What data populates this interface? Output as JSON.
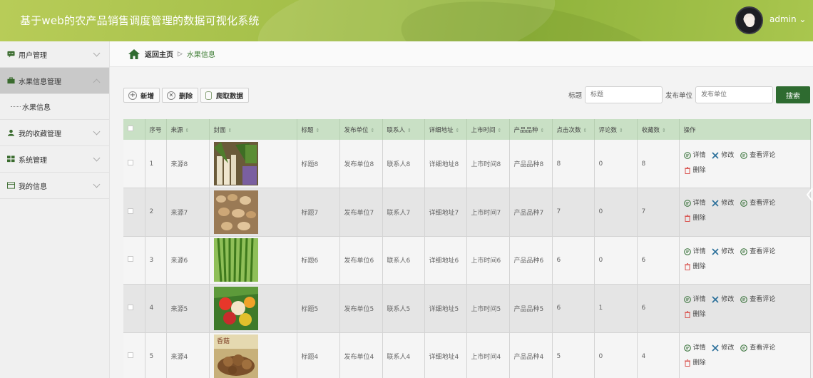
{
  "header": {
    "title": "基于web的农产品销售调度管理的数据可视化系统",
    "user": "admin ⌄"
  },
  "sidebar": {
    "items": [
      {
        "label": "用户管理",
        "icon": "chat-icon",
        "expanded": false
      },
      {
        "label": "水果信息管理",
        "icon": "briefcase-icon",
        "expanded": true,
        "children": [
          {
            "label": "水果信息"
          }
        ]
      },
      {
        "label": "我的收藏管理",
        "icon": "user-icon",
        "expanded": false
      },
      {
        "label": "系统管理",
        "icon": "grid-icon",
        "expanded": false
      },
      {
        "label": "我的信息",
        "icon": "card-icon",
        "expanded": false
      }
    ]
  },
  "breadcrumb": {
    "home": "返回主页",
    "sep": "▷",
    "current": "水果信息"
  },
  "toolbar": {
    "add": "新增",
    "delete": "删除",
    "crawl": "爬取数据"
  },
  "search": {
    "title_label": "标题",
    "title_placeholder": "标题",
    "unit_label": "发布单位",
    "unit_placeholder": "发布单位",
    "button": "搜索"
  },
  "table": {
    "headers": [
      "序号",
      "来源",
      "封面",
      "标题",
      "发布单位",
      "联系人",
      "详细地址",
      "上市时间",
      "产品品种",
      "点击次数",
      "评论数",
      "收藏数",
      "操作"
    ],
    "actions": {
      "detail": "详情",
      "edit": "修改",
      "comments": "查看评论",
      "delete": "删除"
    },
    "rows": [
      {
        "no": "1",
        "source": "来源8",
        "title": "标题8",
        "unit": "发布单位8",
        "contact": "联系人8",
        "address": "详细地址8",
        "date": "上市时间8",
        "variety": "产品品种8",
        "clicks": "8",
        "comments": "0",
        "favs": "8"
      },
      {
        "no": "2",
        "source": "来源7",
        "title": "标题7",
        "unit": "发布单位7",
        "contact": "联系人7",
        "address": "详细地址7",
        "date": "上市时间7",
        "variety": "产品品种7",
        "clicks": "7",
        "comments": "0",
        "favs": "7"
      },
      {
        "no": "3",
        "source": "来源6",
        "title": "标题6",
        "unit": "发布单位6",
        "contact": "联系人6",
        "address": "详细地址6",
        "date": "上市时间6",
        "variety": "产品品种6",
        "clicks": "6",
        "comments": "0",
        "favs": "6"
      },
      {
        "no": "4",
        "source": "来源5",
        "title": "标题5",
        "unit": "发布单位5",
        "contact": "联系人5",
        "address": "详细地址5",
        "date": "上市时间5",
        "variety": "产品品种5",
        "clicks": "6",
        "comments": "1",
        "favs": "6"
      },
      {
        "no": "5",
        "source": "来源4",
        "title": "标题4",
        "unit": "发布单位4",
        "contact": "联系人4",
        "address": "详细地址4",
        "date": "上市时间4",
        "variety": "产品品种4",
        "clicks": "5",
        "comments": "0",
        "favs": "4"
      }
    ]
  },
  "colors": {
    "accent": "#2e6b30",
    "header_green": "#a5c04a",
    "table_head": "#c9e0c5"
  }
}
